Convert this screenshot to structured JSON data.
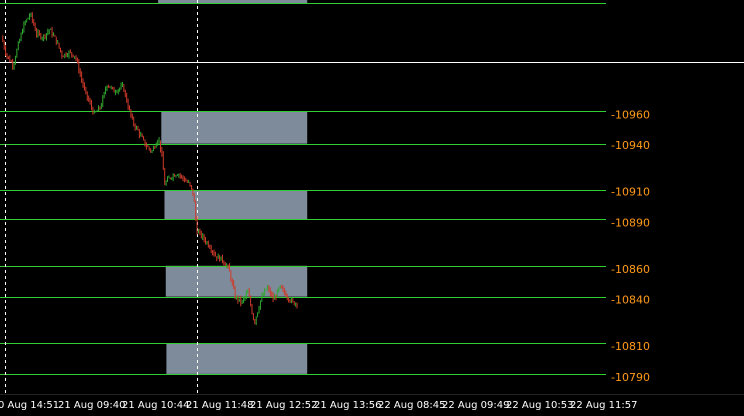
{
  "colors": {
    "background": "#000000",
    "level_line": "#32cd32",
    "zone_fill": "#7d8b9a",
    "current_line": "#ffffff",
    "bull_candle": "#2fa82f",
    "bear_candle": "#d03a2a",
    "price_label": "#ff9a1a",
    "axis_text": "#ffffff",
    "vertical_marker": "#ffffff"
  },
  "chart_data": {
    "type": "line",
    "x": [
      "0 Aug 14:51",
      "21 Aug 09:40",
      "21 Aug 10:44",
      "21 Aug 11:48",
      "21 Aug 12:52",
      "21 Aug 13:56",
      "22 Aug 08:45",
      "22 Aug 09:49",
      "22 Aug 10:53",
      "22 Aug 11:57"
    ],
    "ylim": [
      10779,
      11034
    ],
    "price_labels": [
      "10960",
      "10940",
      "10910",
      "10890",
      "10860",
      "10840",
      "10810",
      "10790"
    ],
    "level_lines": [
      11032,
      10962,
      10941,
      10911,
      10892,
      10862,
      10842,
      10812,
      10792
    ],
    "current_price": 10994,
    "zones": [
      {
        "price_top": 11036,
        "price_bottom": 11032,
        "start": 2.47,
        "end": 4.8
      },
      {
        "price_top": 10962,
        "price_bottom": 10941,
        "start": 2.52,
        "end": 4.8
      },
      {
        "price_top": 10911,
        "price_bottom": 10892,
        "start": 2.57,
        "end": 4.8
      },
      {
        "price_top": 10862,
        "price_bottom": 10842,
        "start": 2.59,
        "end": 4.8
      },
      {
        "price_top": 10812,
        "price_bottom": 10792,
        "start": 2.6,
        "end": 4.8
      }
    ],
    "vertical_markers": [
      0,
      3
    ],
    "series": [
      {
        "values": [
          [
            0,
            11010
          ],
          [
            0.08,
            10998
          ],
          [
            0.18,
            10992
          ],
          [
            0.25,
            11003
          ],
          [
            0.35,
            11018
          ],
          [
            0.45,
            11025
          ],
          [
            0.55,
            11012
          ],
          [
            0.65,
            11010
          ],
          [
            0.75,
            11015
          ],
          [
            0.85,
            11008
          ],
          [
            0.95,
            10998
          ],
          [
            1.05,
            11000
          ],
          [
            1.15,
            10998
          ],
          [
            1.3,
            10975
          ],
          [
            1.45,
            10960
          ],
          [
            1.55,
            10965
          ],
          [
            1.65,
            10980
          ],
          [
            1.75,
            10975
          ],
          [
            1.9,
            10978
          ],
          [
            1.98,
            10965
          ],
          [
            2.05,
            10955
          ],
          [
            2.15,
            10948
          ],
          [
            2.25,
            10940
          ],
          [
            2.35,
            10936
          ],
          [
            2.45,
            10945
          ],
          [
            2.5,
            10935
          ],
          [
            2.55,
            10915
          ],
          [
            2.65,
            10920
          ],
          [
            2.75,
            10922
          ],
          [
            2.85,
            10918
          ],
          [
            2.93,
            10915
          ],
          [
            3.0,
            10908
          ],
          [
            3.05,
            10885
          ],
          [
            3.15,
            10880
          ],
          [
            3.25,
            10875
          ],
          [
            3.35,
            10868
          ],
          [
            3.45,
            10866
          ],
          [
            3.55,
            10860
          ],
          [
            3.65,
            10842
          ],
          [
            3.75,
            10838
          ],
          [
            3.85,
            10845
          ],
          [
            3.95,
            10825
          ],
          [
            4.05,
            10840
          ],
          [
            4.15,
            10848
          ],
          [
            4.25,
            10840
          ],
          [
            4.35,
            10848
          ],
          [
            4.45,
            10843
          ],
          [
            4.55,
            10838
          ],
          [
            4.62,
            10838
          ]
        ]
      }
    ]
  }
}
